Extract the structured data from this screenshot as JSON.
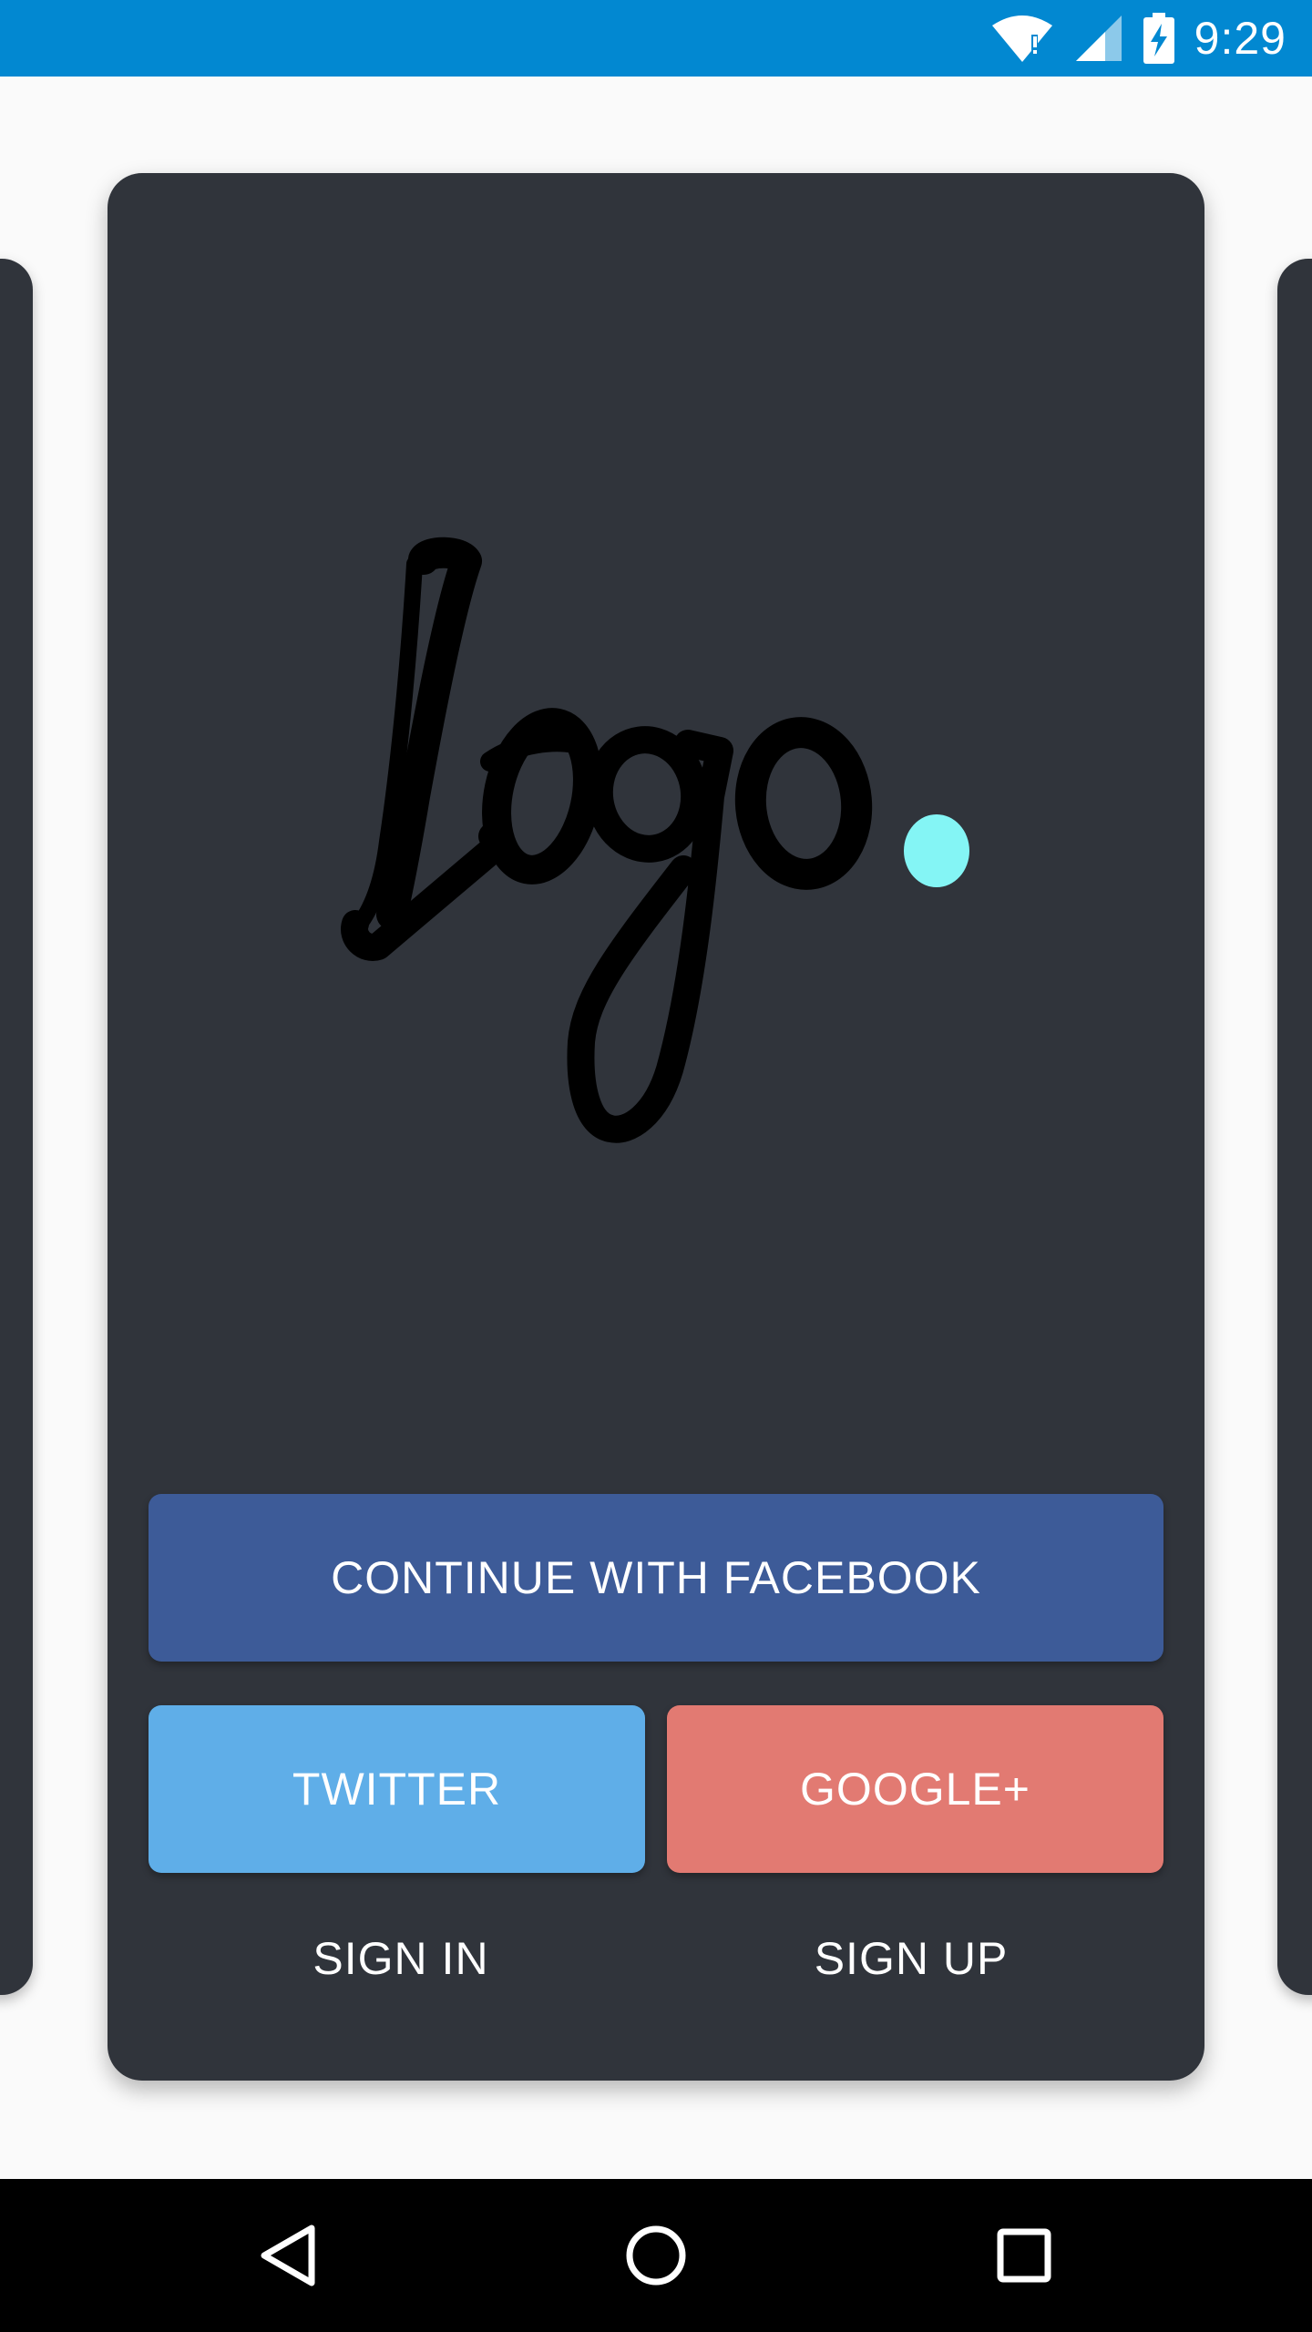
{
  "status_bar": {
    "time": "9:29",
    "icons": [
      "wifi-alert-icon",
      "cell-signal-icon",
      "battery-charging-icon"
    ],
    "color": "#0288d1"
  },
  "logo": {
    "text": "Logo",
    "dot_color": "#84f5f5"
  },
  "auth": {
    "facebook_label": "CONTINUE WITH FACEBOOK",
    "twitter_label": "TWITTER",
    "google_label": "GOOGLE+",
    "signin_label": "SIGN IN",
    "signup_label": "SIGN UP"
  },
  "colors": {
    "card": "#30343b",
    "facebook": "#3d5b98",
    "twitter": "#5faee8",
    "google": "#e27a72"
  },
  "nav_bar": {
    "icons": [
      "back-icon",
      "home-icon",
      "recents-icon"
    ]
  }
}
